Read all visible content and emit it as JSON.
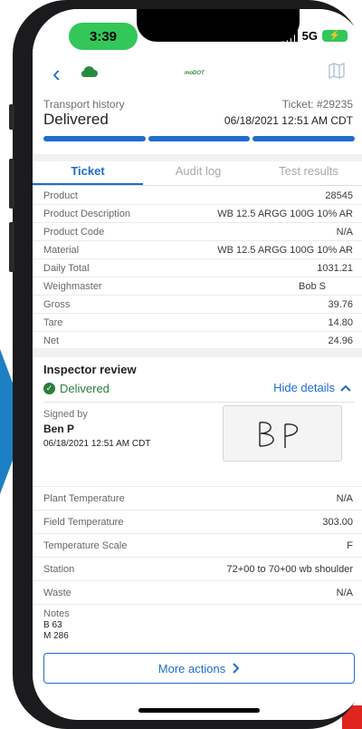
{
  "status_bar": {
    "time": "3:39",
    "network": "5G"
  },
  "nav": {
    "logo_text": "moDOT"
  },
  "header": {
    "section_label": "Transport history",
    "status": "Delivered",
    "ticket_number": "Ticket: #29235",
    "ticket_date": "06/18/2021 12:51 AM CDT",
    "progress_steps_completed": 3,
    "progress_steps_total": 3
  },
  "tabs": [
    {
      "label": "Ticket",
      "active": true
    },
    {
      "label": "Audit log",
      "active": false
    },
    {
      "label": "Test results",
      "active": false
    }
  ],
  "ticket_rows": [
    {
      "label": "Product",
      "value": "28545"
    },
    {
      "label": "Product Description",
      "value": "WB 12.5 ARGG 100G 10% AR"
    },
    {
      "label": "Product Code",
      "value": "N/A"
    },
    {
      "label": "Material",
      "value": "WB 12.5 ARGG 100G 10% AR"
    },
    {
      "label": "Daily Total",
      "value": "1031.21"
    },
    {
      "label": "Weighmaster",
      "value": "Bob S"
    },
    {
      "label": "Gross",
      "value": "39.76"
    },
    {
      "label": "Tare",
      "value": "14.80"
    },
    {
      "label": "Net",
      "value": "24.96"
    }
  ],
  "inspector": {
    "title": "Inspector review",
    "status": "Delivered",
    "toggle_label": "Hide details",
    "signed_by_label": "Signed by",
    "signed_by_name": "Ben P",
    "signed_date": "06/18/2021 12:51 AM CDT",
    "signature_initials": "BP"
  },
  "details": [
    {
      "label": "Plant Temperature",
      "value": "N/A"
    },
    {
      "label": "Field Temperature",
      "value": "303.00"
    },
    {
      "label": "Temperature Scale",
      "value": "F"
    },
    {
      "label": "Station",
      "value": "72+00 to 70+00 wb shoulder"
    },
    {
      "label": "Waste",
      "value": "N/A"
    }
  ],
  "notes": {
    "label": "Notes",
    "lines": [
      "B 63",
      "M 286"
    ]
  },
  "actions": {
    "more_label": "More actions"
  },
  "colors": {
    "accent": "#1f6ccf",
    "success": "#2a7d3c",
    "status_pill": "#33c759"
  }
}
